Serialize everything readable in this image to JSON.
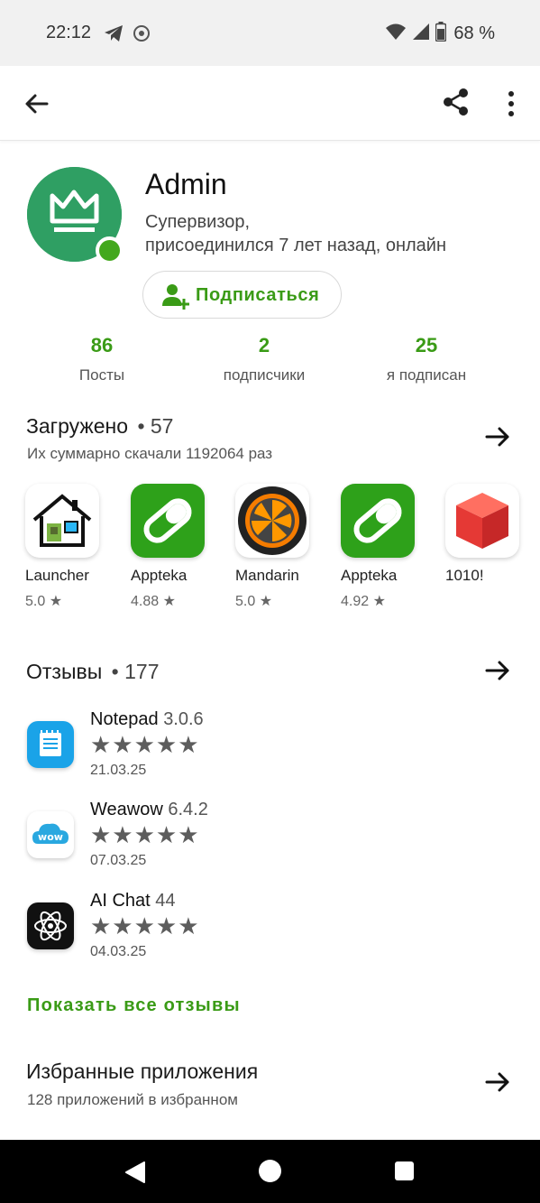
{
  "status_bar": {
    "time": "22:12",
    "battery": "68 %",
    "icons": [
      "telegram-icon",
      "misc-app-icon",
      "wifi-icon",
      "signal-icon",
      "battery-icon"
    ]
  },
  "toolbar": {
    "icons": [
      "back-arrow-icon",
      "share-icon",
      "more-vert-icon"
    ]
  },
  "profile": {
    "name": "Admin",
    "role_line": "Супервизор,",
    "joined_line": "присоединился 7 лет назад, онлайн",
    "subscribe_label": "Подписаться",
    "avatar_color": "#2e9e5e",
    "online_color": "#43a81d"
  },
  "stats": [
    {
      "value": "86",
      "label": "Посты"
    },
    {
      "value": "2",
      "label": "подписчики"
    },
    {
      "value": "25",
      "label": "я подписан"
    }
  ],
  "uploaded": {
    "title": "Загружено",
    "separator": "•",
    "count": "57",
    "subtitle": "Их суммарно скачали 1192064 раз",
    "apps": [
      {
        "name": "Launcher",
        "rating": "5.0 ★",
        "icon": "house-icon"
      },
      {
        "name": "Appteka",
        "rating": "4.88 ★",
        "icon": "pill-icon"
      },
      {
        "name": "Mandarin",
        "rating": "5.0 ★",
        "icon": "orange-slice-icon"
      },
      {
        "name": "Appteka",
        "rating": "4.92 ★",
        "icon": "pill-icon"
      },
      {
        "name": "1010!",
        "rating": "",
        "icon": "cube-icon"
      }
    ]
  },
  "reviews": {
    "title": "Отзывы",
    "separator": "•",
    "count": "177",
    "items": [
      {
        "app": "Notepad",
        "version": "3.0.6",
        "stars": "★★★★★",
        "date": "21.03.25",
        "icon": "notepad-icon"
      },
      {
        "app": "Weawow",
        "version": "6.4.2",
        "stars": "★★★★★",
        "date": "07.03.25",
        "icon": "weawow-cloud-icon"
      },
      {
        "app": "AI Chat",
        "version": "44",
        "stars": "★★★★★",
        "date": "04.03.25",
        "icon": "atom-icon"
      }
    ],
    "show_all_label": "Показать все отзывы"
  },
  "favorites": {
    "title": "Избранные приложения",
    "subtitle": "128 приложений в избранном"
  },
  "colors": {
    "accent_green": "#3a9b16",
    "appteka_green": "#2ea11a"
  }
}
